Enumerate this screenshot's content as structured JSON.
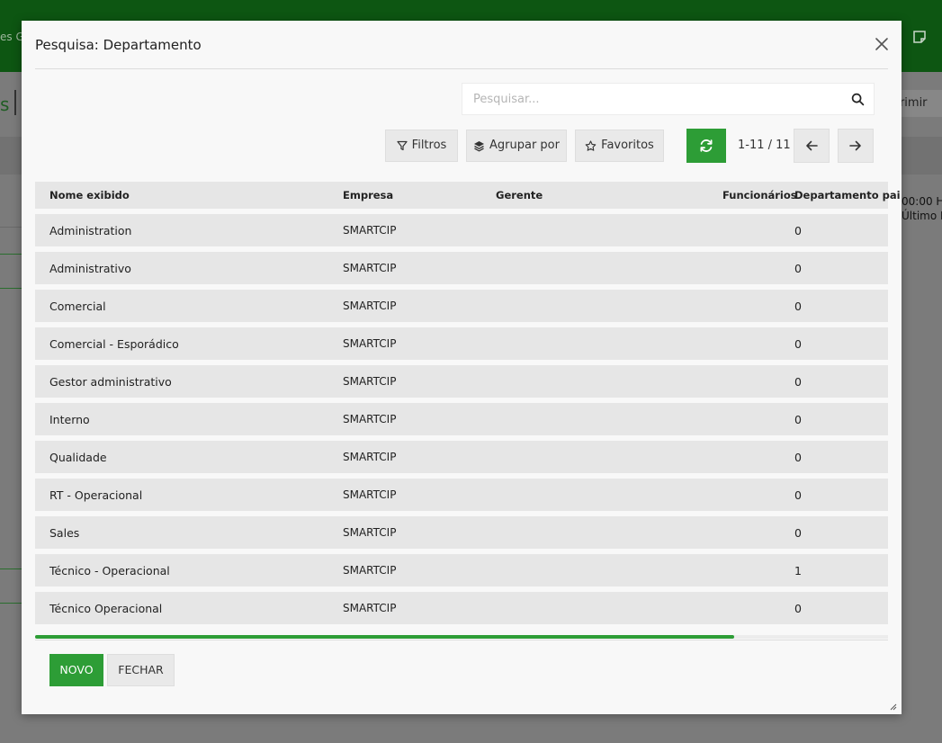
{
  "background": {
    "topbar_fragment": "es G",
    "heading_fragment": "s",
    "print_button_fragment": "orimir",
    "side_text_line1": "00:00 H",
    "side_text_line2": "Último M",
    "icons": [
      "note-icon"
    ]
  },
  "modal": {
    "title": "Pesquisa: Departamento",
    "search": {
      "placeholder": "Pesquisar...",
      "value": ""
    },
    "toolbar": {
      "filters_label": "Filtros",
      "group_by_label": "Agrupar por",
      "favorites_label": "Favoritos",
      "pager": "1-11 / 11"
    },
    "table": {
      "columns": [
        "Nome exibido",
        "Empresa",
        "Gerente",
        "Funcionários",
        "Departamento pai"
      ],
      "rows": [
        {
          "name": "Administration",
          "company": "SMARTCIP",
          "manager": "",
          "employees": "0",
          "parent": ""
        },
        {
          "name": "Administrativo",
          "company": "SMARTCIP",
          "manager": "",
          "employees": "0",
          "parent": ""
        },
        {
          "name": "Comercial",
          "company": "SMARTCIP",
          "manager": "",
          "employees": "0",
          "parent": ""
        },
        {
          "name": "Comercial - Esporádico",
          "company": "SMARTCIP",
          "manager": "",
          "employees": "0",
          "parent": ""
        },
        {
          "name": "Gestor administrativo",
          "company": "SMARTCIP",
          "manager": "",
          "employees": "0",
          "parent": ""
        },
        {
          "name": "Interno",
          "company": "SMARTCIP",
          "manager": "",
          "employees": "0",
          "parent": ""
        },
        {
          "name": "Qualidade",
          "company": "SMARTCIP",
          "manager": "",
          "employees": "0",
          "parent": ""
        },
        {
          "name": "RT - Operacional",
          "company": "SMARTCIP",
          "manager": "",
          "employees": "0",
          "parent": ""
        },
        {
          "name": "Sales",
          "company": "SMARTCIP",
          "manager": "",
          "employees": "0",
          "parent": ""
        },
        {
          "name": "Técnico - Operacional",
          "company": "SMARTCIP",
          "manager": "",
          "employees": "1",
          "parent": ""
        },
        {
          "name": "Técnico Operacional",
          "company": "SMARTCIP",
          "manager": "",
          "employees": "0",
          "parent": ""
        }
      ]
    },
    "horizontal_scroll_fraction": 0.82,
    "footer": {
      "new_label": "NOVO",
      "close_label": "FECHAR"
    },
    "icons": [
      "close-icon",
      "search-icon",
      "filter-icon",
      "layers-icon",
      "star-icon",
      "refresh-icon",
      "arrow-left-icon",
      "arrow-right-icon",
      "resize-grip-icon"
    ]
  },
  "colors": {
    "accent": "#2d9d36",
    "topbar": "#0d5612",
    "overlay": "#7b7b7b",
    "row_background": "#e6e6e6"
  }
}
